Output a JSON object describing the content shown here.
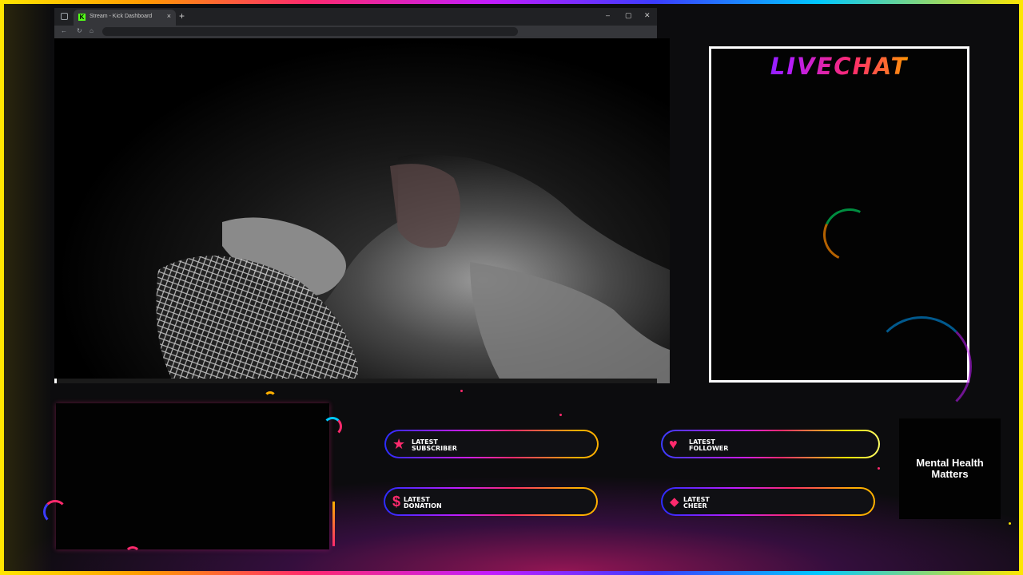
{
  "browser": {
    "tab_title": "Stream - Kick Dashboard",
    "tab_favicon": "K",
    "new_tab": "+",
    "window_controls": [
      "–",
      "▢",
      "✕"
    ]
  },
  "chat": {
    "title": "LIVECHAT"
  },
  "widgets": {
    "subscriber": {
      "label": "LATEST\nSUBSCRIBER",
      "icon": "star-icon"
    },
    "follower": {
      "label": "LATEST\nFOLLOWER",
      "icon": "heart-icon"
    },
    "donation": {
      "label": "LATEST\nDONATION",
      "icon": "dollar-icon"
    },
    "cheer": {
      "label": "LATEST\nCHEER",
      "icon": "diamond-icon"
    }
  },
  "banner": {
    "text": "Mental Health Matters"
  },
  "colors": {
    "accent_pink": "#ff2a6d",
    "kick_green": "#53fc18",
    "frame_gradient": [
      "#ffe600",
      "#ff9a00",
      "#ff2a6d",
      "#c21cff",
      "#3b3cff",
      "#00c8ff"
    ]
  }
}
